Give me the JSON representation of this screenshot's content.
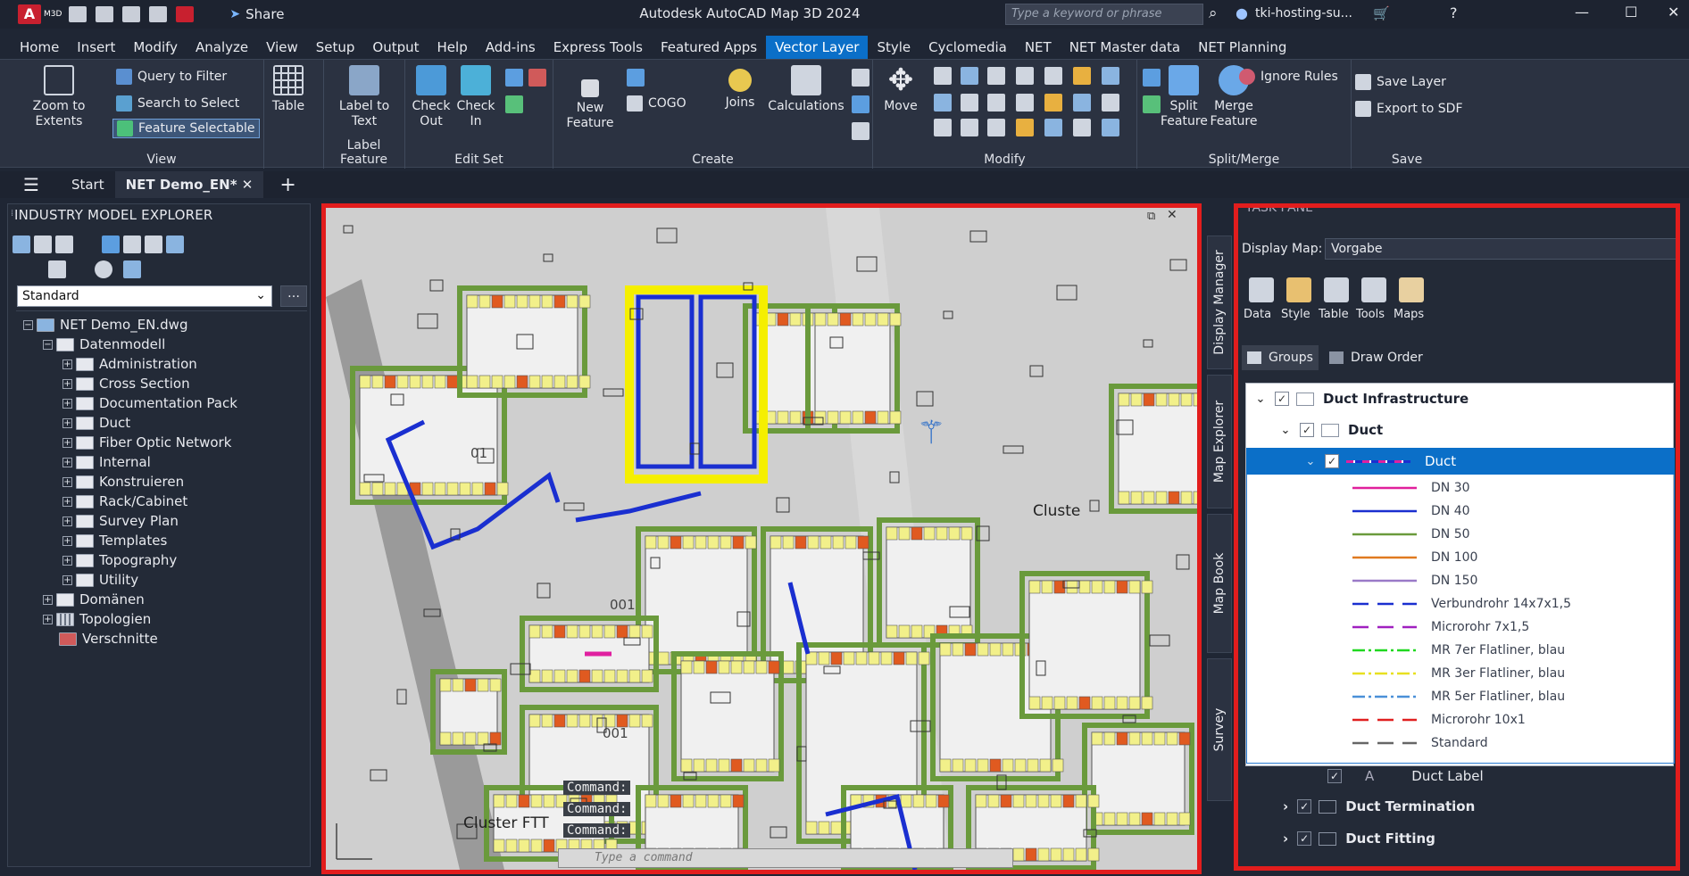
{
  "app": {
    "logo_text": "A",
    "logo_sub": "M3D",
    "share_label": "Share",
    "title": "Autodesk AutoCAD Map 3D 2024",
    "search_placeholder": "Type a keyword or phrase",
    "user": "tki-hosting-su..."
  },
  "menu": [
    "Home",
    "Insert",
    "Modify",
    "Analyze",
    "View",
    "Setup",
    "Output",
    "Help",
    "Add-ins",
    "Express Tools",
    "Featured Apps",
    "Vector Layer",
    "Style",
    "Cyclomedia",
    "NET",
    "NET Master data",
    "NET Planning"
  ],
  "menu_active": "Vector Layer",
  "ribbon": {
    "view": {
      "zoom": "Zoom to Extents",
      "query": "Query to Filter",
      "search": "Search to Select",
      "selectable": "Feature Selectable",
      "table": "Table",
      "label": "View"
    },
    "label_feature": {
      "btn": "Label to Text",
      "label": "Label Feature"
    },
    "edit_set": {
      "out": "Check Out",
      "in": "Check In",
      "label": "Edit Set"
    },
    "create": {
      "new": "New Feature",
      "cogo": "COGO",
      "joins": "Joins",
      "calc": "Calculations",
      "label": "Create"
    },
    "modify": {
      "move": "Move",
      "label": "Modify"
    },
    "split": {
      "split": "Split Feature",
      "merge": "Merge Feature",
      "ignore": "Ignore Rules",
      "label": "Split/Merge"
    },
    "save": {
      "save_layer": "Save Layer",
      "export": "Export to SDF",
      "label": "Save"
    }
  },
  "tabs": {
    "start": "Start",
    "doc": "NET Demo_EN*"
  },
  "explorer": {
    "title": "INDUSTRY MODEL EXPLORER",
    "combo": "Standard",
    "root": "NET Demo_EN.dwg",
    "group": "Datenmodell",
    "items": [
      "Administration",
      "Cross Section",
      "Documentation Pack",
      "Duct",
      "Fiber Optic Network",
      "Internal",
      "Konstruieren",
      "Rack/Cabinet",
      "Survey Plan",
      "Templates",
      "Topography",
      "Utility"
    ],
    "domains": "Domänen",
    "topologies": "Topologien",
    "links": "Verschnitte"
  },
  "map": {
    "cluster1": "Cluste",
    "cluster2": "Cluster FTT",
    "label1": "01",
    "label2": "001",
    "label3": "001",
    "cmd_lines": [
      "Command:",
      "Command:",
      "Command:"
    ],
    "cmd_placeholder": "Type a command"
  },
  "side_tabs": [
    "Display Manager",
    "Map Explorer",
    "Map Book",
    "Survey"
  ],
  "taskpane": {
    "title": "TASK PANE",
    "display_map_label": "Display Map:",
    "display_map_value": "Vorgabe",
    "tools": [
      "Data",
      "Style",
      "Table",
      "Tools",
      "Maps"
    ],
    "groups_label": "Groups",
    "draw_order_label": "Draw Order",
    "layers": {
      "infra": "Duct Infrastructure",
      "duct_group": "Duct",
      "duct_layer": "Duct",
      "duct_label": "Duct Label",
      "termination": "Duct Termination",
      "fitting": "Duct Fitting"
    },
    "legend": [
      {
        "name": "DN 30",
        "color": "#e0209c",
        "dash": ""
      },
      {
        "name": "DN 40",
        "color": "#1a2fd0",
        "dash": ""
      },
      {
        "name": "DN 50",
        "color": "#6a9a3c",
        "dash": ""
      },
      {
        "name": "DN 100",
        "color": "#e07a20",
        "dash": ""
      },
      {
        "name": "DN 150",
        "color": "#9a7ac8",
        "dash": ""
      },
      {
        "name": "Verbundrohr 14x7x1,5",
        "color": "#1a2fd0",
        "dash": "18,10"
      },
      {
        "name": "Microrohr 7x1,5",
        "color": "#a020c0",
        "dash": "18,10"
      },
      {
        "name": "MR 7er Flatliner, blau",
        "color": "#20d820",
        "dash": "14,4,3,4"
      },
      {
        "name": "MR 3er Flatliner, blau",
        "color": "#e8e020",
        "dash": "14,4,3,4"
      },
      {
        "name": "MR 5er Flatliner, blau",
        "color": "#4a90d8",
        "dash": "14,4,3,4"
      },
      {
        "name": "Microrohr 10x1",
        "color": "#e02020",
        "dash": "18,10"
      },
      {
        "name": "Standard",
        "color": "#666666",
        "dash": "18,10"
      }
    ]
  }
}
